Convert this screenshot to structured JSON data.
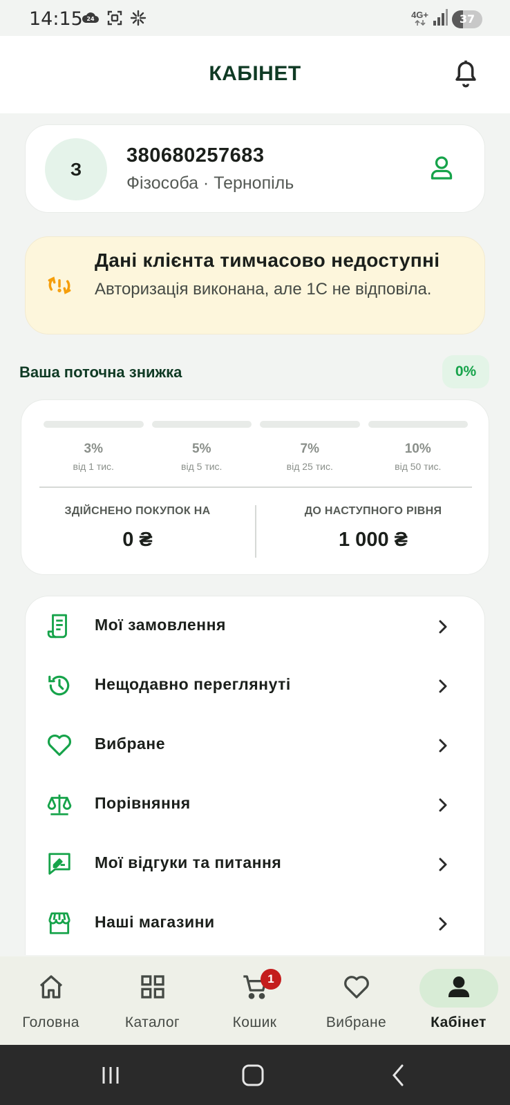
{
  "status_bar": {
    "time": "14:15",
    "network": "4G+",
    "battery": "37",
    "battery_level": 0.37,
    "icons_left": [
      "cloud-24-icon",
      "screenshot-icon",
      "sparkle-icon"
    ],
    "icons_right": [
      "network-4g-icon",
      "signal-icon",
      "battery-icon"
    ],
    "cloud_badge": "24"
  },
  "header": {
    "title": "КАБІНЕТ",
    "icon": "bell-icon"
  },
  "profile": {
    "avatar_letter": "З",
    "phone": "380680257683",
    "subinfo": "Фізособа · Тернопіль",
    "icon": "user-icon"
  },
  "warning": {
    "title": "Дані клієнта тимчасово недоступні",
    "text": "Авторизація виконана, але 1С не відповіла.",
    "icon": "sync-alert-icon"
  },
  "discount": {
    "label": "Ваша поточна знижка",
    "current": "0%",
    "tiers": [
      {
        "pct": "3%",
        "from": "від 1 тис."
      },
      {
        "pct": "5%",
        "from": "від 5 тис."
      },
      {
        "pct": "7%",
        "from": "від 25 тис."
      },
      {
        "pct": "10%",
        "from": "від 50 тис."
      }
    ],
    "purchased_label": "ЗДІЙСНЕНО ПОКУПОК НА",
    "purchased_value": "0 ₴",
    "next_label": "ДО НАСТУПНОГО РІВНЯ",
    "next_value": "1 000 ₴"
  },
  "menu": {
    "items": [
      {
        "label": "Мої замовлення",
        "icon": "receipt-icon"
      },
      {
        "label": "Нещодавно переглянуті",
        "icon": "history-icon"
      },
      {
        "label": "Вибране",
        "icon": "heart-icon"
      },
      {
        "label": "Порівняння",
        "icon": "scales-icon"
      },
      {
        "label": "Мої відгуки та питання",
        "icon": "review-icon"
      },
      {
        "label": "Наші магазини",
        "icon": "store-icon"
      }
    ]
  },
  "bottom_nav": {
    "items": [
      {
        "label": "Головна",
        "icon": "home-icon"
      },
      {
        "label": "Каталог",
        "icon": "grid-icon"
      },
      {
        "label": "Кошик",
        "icon": "cart-icon",
        "badge": "1"
      },
      {
        "label": "Вибране",
        "icon": "heart-icon"
      },
      {
        "label": "Кабінет",
        "icon": "person-icon",
        "active": true
      }
    ]
  },
  "colors": {
    "accent_green": "#16a34a",
    "title_green": "#0f3a24",
    "warning_bg": "#fdf6dc",
    "warning_icon": "#f59e0b",
    "badge_red": "#c41d1d"
  }
}
